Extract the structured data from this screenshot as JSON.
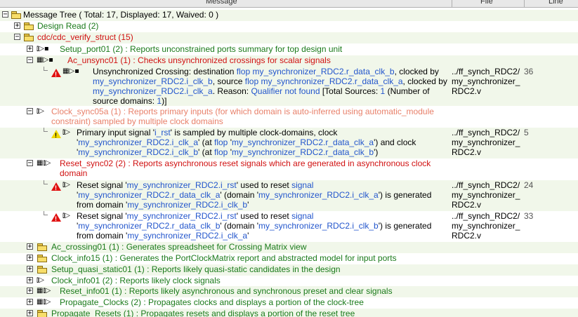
{
  "header": {
    "message": "Message",
    "file": "File",
    "line": "Line"
  },
  "root": {
    "label": "Message Tree ( Total: 17, Displayed: 17, Waived: 0 )"
  },
  "design_read": {
    "label": "Design Read (2)"
  },
  "cdc": {
    "label": "cdc/cdc_verify_struct (15)"
  },
  "setup_port": {
    "label": "Setup_port01 (2) : Reports unconstrained ports summary for top design unit"
  },
  "ac_unsync": {
    "label": "Ac_unsync01 (1) : Checks unsynchronized crossings for scalar signals"
  },
  "msg1": {
    "l1a": "Unsynchronized Crossing: destination ",
    "l1b": "flop my_synchronizer_RDC2.r_data_clk_b",
    "l1c": ", clocked by",
    "l2a": "my_synchronizer_RDC2.i_clk_b",
    "l2b": ", source ",
    "l2c": "flop my_synchronizer_RDC2.r_data_clk_a",
    "l2d": ", clocked by",
    "l3a": "my_synchronizer_RDC2.i_clk_a",
    "l3b": ". Reason: ",
    "l3c": "Qualifier not found",
    "l3d": " [Total Sources: ",
    "l3e": "1",
    "l3f": " (Number of",
    "l4a": "source domains: ",
    "l4b": "1",
    "l4c": ")]",
    "file1": "../ff_synch_RDC2/",
    "file2": "my_synchronizer_",
    "file3": "RDC2.v",
    "line": "36"
  },
  "clock_sync": {
    "l1": "Clock_sync05a (1) : Reports primary inputs (for which domain is auto-inferred using automatic_module",
    "l2": "constraint) sampled by multiple clock domains"
  },
  "msg2": {
    "l1a": "Primary input signal '",
    "l1b": "i_rst",
    "l1c": "' is sampled by multiple clock-domains, clock",
    "l2a": "'",
    "l2b": "my_synchronizer_RDC2.i_clk_a",
    "l2c": "' (at ",
    "l2d": "flop",
    "l2e": " '",
    "l2f": "my_synchronizer_RDC2.r_data_clk_a",
    "l2g": "') and clock",
    "l3a": "'",
    "l3b": "my_synchronizer_RDC2.i_clk_b",
    "l3c": "' (at ",
    "l3d": "flop",
    "l3e": " '",
    "l3f": "my_synchronizer_RDC2.r_data_clk_b",
    "l3g": "')",
    "file1": "../ff_synch_RDC2/",
    "file2": "my_synchronizer_",
    "file3": "RDC2.v",
    "line": "5"
  },
  "reset_sync": {
    "l1": "Reset_sync02 (2) : Reports asynchronous reset signals which are generated in asynchronous clock",
    "l2": "domain"
  },
  "msg3": {
    "l1a": "Reset signal '",
    "l1b": "my_synchronizer_RDC2.i_rst",
    "l1c": "' used to reset ",
    "l1d": "signal",
    "l2a": "'",
    "l2b": "my_synchronizer_RDC2.r_data_clk_a",
    "l2c": "' (domain '",
    "l2d": "my_synchronizer_RDC2.i_clk_a",
    "l2e": "') is generated",
    "l3a": "from domain '",
    "l3b": "my_synchronizer_RDC2.i_clk_b",
    "l3c": "'",
    "file1": "../ff_synch_RDC2/",
    "file2": "my_synchronizer_",
    "file3": "RDC2.v",
    "line": "24"
  },
  "msg4": {
    "l1a": "Reset signal '",
    "l1b": "my_synchronizer_RDC2.i_rst",
    "l1c": "' used to reset ",
    "l1d": "signal",
    "l2a": "'",
    "l2b": "my_synchronizer_RDC2.r_data_clk_b",
    "l2c": "' (domain '",
    "l2d": "my_synchronizer_RDC2.i_clk_b",
    "l2e": "') is generated",
    "l3a": "from domain '",
    "l3b": "my_synchronizer_RDC2.i_clk_a",
    "l3c": "'",
    "file1": "../ff_synch_RDC2/",
    "file2": "my_synchronizer_",
    "file3": "RDC2.v",
    "line": "33"
  },
  "rules": [
    {
      "label": "Ac_crossing01 (1) : Generates spreadsheet for Crossing Matrix view"
    },
    {
      "label": "Clock_info15 (1) : Generates the PortClockMatrix report and abstracted model for input ports"
    },
    {
      "label": "Setup_quasi_static01 (1) : Reports likely quasi-static candidates in the design"
    },
    {
      "label": "Clock_info01 (2) : Reports likely clock signals"
    },
    {
      "label": "Reset_info01 (1) : Reports likely asynchronous and synchronous preset and clear signals"
    },
    {
      "label": "Propagate_Clocks (2) : Propagates clocks and displays a portion of the clock-tree"
    },
    {
      "label": "Propagate_Resets (1) : Propagates resets and displays a portion of the reset tree"
    }
  ],
  "colors": {
    "rule_green": "#1a7a1a",
    "rule_red": "#d01010",
    "link_blue": "#2255cc",
    "row_bg": "#f1f7ea"
  }
}
